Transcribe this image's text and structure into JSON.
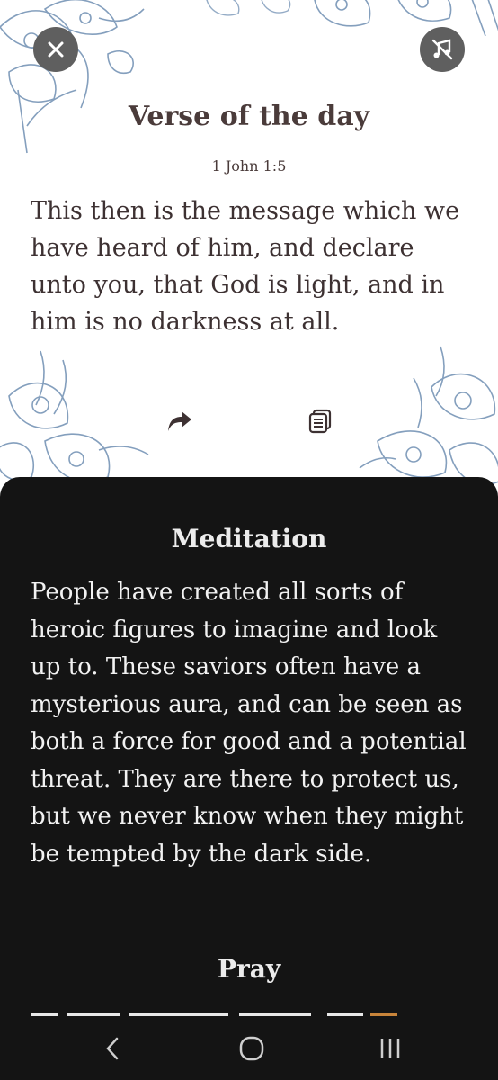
{
  "verse": {
    "title": "Verse of the day",
    "reference": "1 John 1:5",
    "text": "This then is the message which we have heard of him, and declare unto you, that God is light, and in him is no darkness at all."
  },
  "buttons": {
    "close_icon": "close-icon",
    "music_off_icon": "music-off-icon",
    "share_icon": "share-icon",
    "copy_icon": "copy-icon"
  },
  "meditation": {
    "heading": "Meditation",
    "text": "People have created all sorts of heroic figures to imagine and look up to. These saviors often have a mysterious aura, and can be seen as both a force for good and a potential threat. They are there to protect us, but we never know when they might be tempted by the dark side."
  },
  "pray": {
    "heading": "Pray"
  },
  "navbar": {
    "back_icon": "back-icon",
    "home_icon": "home-icon",
    "recents_icon": "recents-icon"
  },
  "colors": {
    "title": "#4a3b3a",
    "sheet_background": "#141414",
    "floral": "#5b7fa8",
    "accent": "#c8843a"
  }
}
